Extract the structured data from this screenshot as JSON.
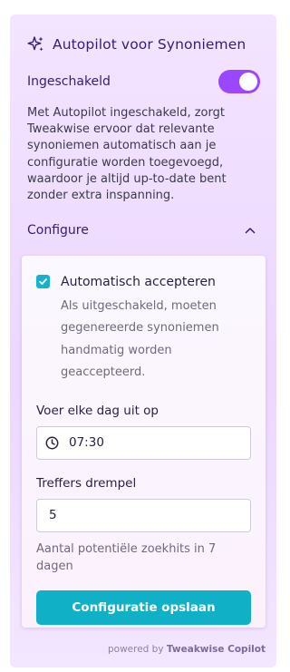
{
  "panel": {
    "title": "Autopilot voor Synoniemen",
    "title_icon": "sparkle-icon",
    "enabled_label": "Ingeschakeld",
    "enabled_on": true,
    "description": "Met Autopilot ingeschakeld, zorgt Tweakwise ervoor dat relevante synoniemen automatisch aan je configuratie worden toegevoegd, waardoor je altijd up-to-date bent zonder extra inspanning.",
    "configure_label": "Configure",
    "configure_icon": "chevron-up-icon"
  },
  "config": {
    "auto_accept_label": "Automatisch accepteren",
    "auto_accept_checked": true,
    "auto_accept_help": "Als uitgeschakeld, moeten gegenereerde synoniemen handmatig worden geaccepteerd.",
    "schedule_label": "Voer elke dag uit op",
    "schedule_value": "07:30",
    "schedule_icon": "clock-icon",
    "threshold_label": "Treffers drempel",
    "threshold_value": "5",
    "threshold_help": "Aantal potentiële zoekhits in 7 dagen",
    "save_label": "Configuratie opslaan"
  },
  "footer": {
    "prefix": "powered by",
    "brand": "Tweakwise Copilot"
  },
  "colors": {
    "accent_purple": "#9b47ff",
    "title_purple": "#3a1d72",
    "teal": "#10b1c7"
  }
}
